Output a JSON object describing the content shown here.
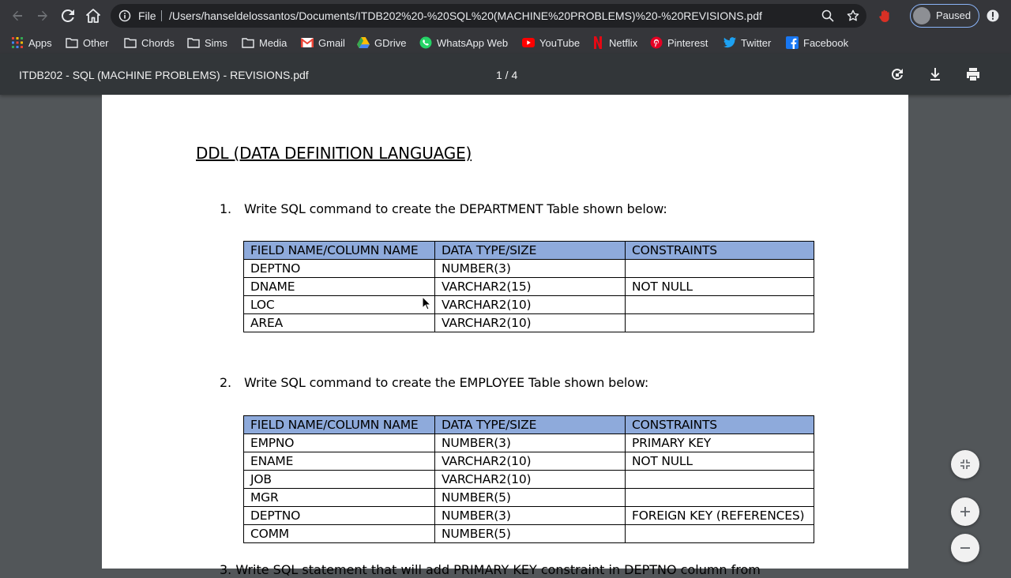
{
  "browser": {
    "url_scheme_label": "File",
    "url": "/Users/hanseldelossantos/Documents/ITDB202%20-%20SQL%20(MACHINE%20PROBLEMS)%20-%20REVISIONS.pdf",
    "profile_label": "Paused"
  },
  "bookmarks": [
    {
      "label": "Apps",
      "icon": "apps-grid-icon"
    },
    {
      "label": "Other",
      "icon": "folder-icon"
    },
    {
      "label": "Chords",
      "icon": "folder-icon"
    },
    {
      "label": "Sims",
      "icon": "folder-icon"
    },
    {
      "label": "Media",
      "icon": "folder-icon"
    },
    {
      "label": "Gmail",
      "icon": "gmail-icon"
    },
    {
      "label": "GDrive",
      "icon": "gdrive-icon"
    },
    {
      "label": "WhatsApp Web",
      "icon": "whatsapp-icon"
    },
    {
      "label": "YouTube",
      "icon": "youtube-icon"
    },
    {
      "label": "Netflix",
      "icon": "netflix-icon"
    },
    {
      "label": "Pinterest",
      "icon": "pinterest-icon"
    },
    {
      "label": "Twitter",
      "icon": "twitter-icon"
    },
    {
      "label": "Facebook",
      "icon": "facebook-icon"
    }
  ],
  "pdf": {
    "title": "ITDB202 - SQL (MACHINE PROBLEMS) - REVISIONS.pdf",
    "page_indicator": "1 / 4"
  },
  "doc": {
    "heading": "DDL (DATA DEFINITION LANGUAGE)",
    "q1": {
      "num": "1.",
      "text": "Write SQL command to create the DEPARTMENT Table shown below:"
    },
    "q2": {
      "num": "2.",
      "text": "Write SQL command to create the EMPLOYEE Table shown below:"
    },
    "q3_partial": "3.   Write SQL statement that will add PRIMARY KEY constraint in DEPTNO column from",
    "headers": [
      "FIELD NAME/COLUMN NAME",
      "DATA TYPE/SIZE",
      "CONSTRAINTS"
    ],
    "table1": [
      [
        "DEPTNO",
        "NUMBER(3)",
        ""
      ],
      [
        "DNAME",
        "VARCHAR2(15)",
        "NOT NULL"
      ],
      [
        "LOC",
        "VARCHAR2(10)",
        ""
      ],
      [
        "AREA",
        "VARCHAR2(10)",
        ""
      ]
    ],
    "table2": [
      [
        "EMPNO",
        "NUMBER(3)",
        "PRIMARY KEY"
      ],
      [
        "ENAME",
        "VARCHAR2(10)",
        "NOT NULL"
      ],
      [
        "JOB",
        "VARCHAR2(10)",
        ""
      ],
      [
        "MGR",
        "NUMBER(5)",
        ""
      ],
      [
        "DEPTNO",
        "NUMBER(3)",
        "FOREIGN KEY (REFERENCES)"
      ],
      [
        "COMM",
        "NUMBER(5)",
        ""
      ]
    ]
  },
  "colors": {
    "table_header": "#8eaadb",
    "toolbar": "#323639",
    "viewer_bg": "#525659"
  }
}
